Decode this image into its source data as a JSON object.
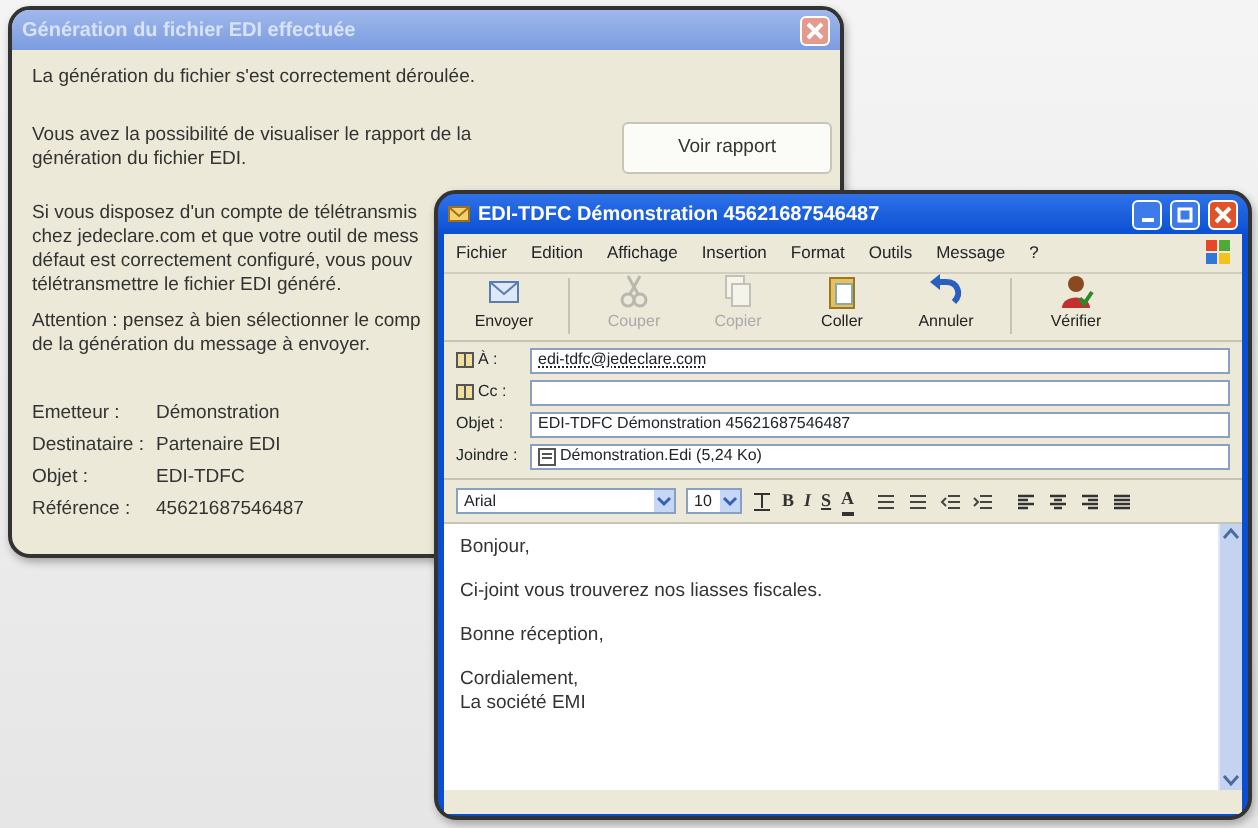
{
  "report_dialog": {
    "title": "Génération du fichier EDI effectuée",
    "active": false,
    "message": "La génération du fichier s'est correctement déroulée.",
    "report_text": [
      "Vous avez la possibilité de visualiser le rapport de la",
      "génération du fichier EDI."
    ],
    "report_button": "Voir rapport",
    "transmit_text": [
      "Si vous disposez d'un compte de télétransmis",
      "chez jedeclare.com et que votre outil de mess",
      "défaut est correctement configuré, vous pouv",
      "télétransmettre le fichier EDI généré."
    ],
    "attention_text": [
      "Attention : pensez à bien sélectionner le comp",
      "de la génération du message à envoyer."
    ],
    "info": [
      {
        "label": "Emetteur :",
        "value": "Démonstration"
      },
      {
        "label": "Destinataire :",
        "value": "Partenaire EDI"
      },
      {
        "label": "Objet :",
        "value": "EDI-TDFC"
      },
      {
        "label": "Référence :",
        "value": "45621687546487"
      }
    ]
  },
  "mail_window": {
    "title": "EDI-TDFC Démonstration 45621687546487",
    "active": true,
    "menu": [
      "Fichier",
      "Edition",
      "Affichage",
      "Insertion",
      "Format",
      "Outils",
      "Message",
      "?"
    ],
    "toolbar": [
      {
        "label": "Envoyer",
        "disabled": false
      },
      {
        "label": "Couper",
        "disabled": true
      },
      {
        "label": "Copier",
        "disabled": true
      },
      {
        "label": "Coller",
        "disabled": false
      },
      {
        "label": "Annuler",
        "disabled": false
      },
      {
        "label": "Vérifier",
        "disabled": false
      }
    ],
    "fields": [
      {
        "kind": "address",
        "label": "À :",
        "value": "edi-tdfc@jedeclare.com"
      },
      {
        "kind": "address",
        "label": "Cc :"
      },
      {
        "kind": "text",
        "label": "Objet :",
        "value": "EDI-TDFC Démonstration 45621687546487"
      },
      {
        "kind": "attachment",
        "label": "Joindre :",
        "value": "Démonstration.Edi (5,24 Ko)"
      }
    ],
    "format_bar": {
      "font": "Arial",
      "size": "10",
      "style_buttons": [
        "B",
        "I",
        "S",
        "A"
      ]
    },
    "body": [
      [
        "Bonjour,"
      ],
      [
        "Ci-joint vous trouverez nos liasses fiscales."
      ],
      [
        "Bonne réception,"
      ],
      [
        "Cordialement,",
        "La société EMI"
      ]
    ]
  }
}
